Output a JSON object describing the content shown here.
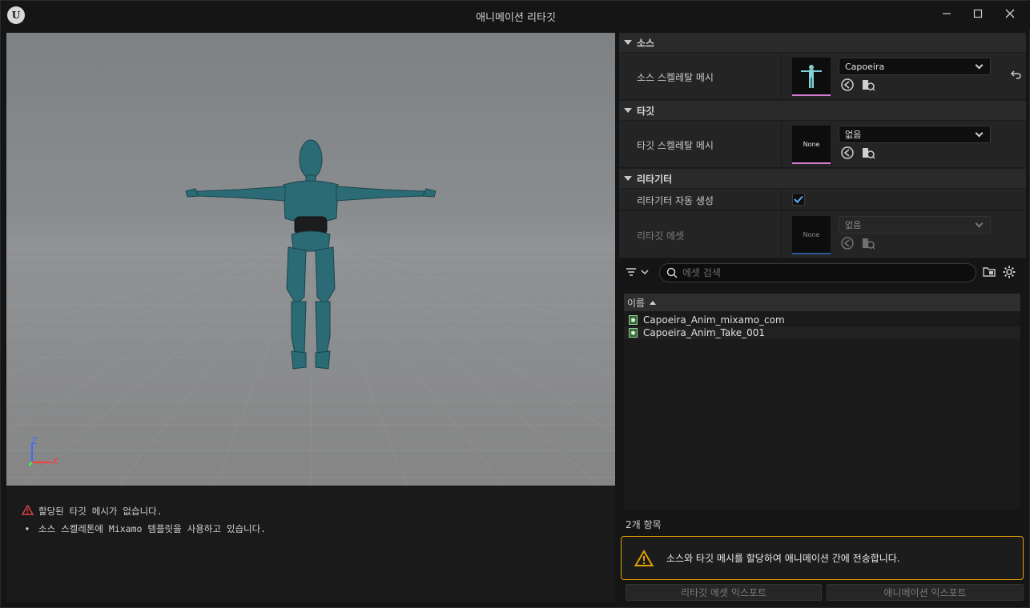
{
  "window": {
    "title": "애니메이션 리타깃",
    "logo_glyph": "U",
    "minimize_icon": "minimize-icon",
    "maximize_icon": "maximize-icon",
    "close_icon": "close-icon"
  },
  "viewport": {
    "axis_labels": {
      "z": "Z",
      "x": "X"
    },
    "axis_colors": {
      "z": "#3c6cff",
      "x": "#ff3c3c",
      "y": "#3cff3c"
    },
    "character_color": "#2b6b76"
  },
  "messages": [
    {
      "icon": "warning-icon",
      "text": "할당된 타깃 메시가 없습니다."
    },
    {
      "icon": "bullet",
      "text": "소스 스켈레톤에 Mixamo 템플릿을 사용하고 있습니다."
    }
  ],
  "details": {
    "source": {
      "header": "소스",
      "mesh_label": "소스 스켈레탈 메시",
      "mesh_value": "Capoeira",
      "reset_icon": "reset-arrow-icon"
    },
    "target": {
      "header": "타깃",
      "mesh_label": "타깃 스켈레탈 메시",
      "mesh_value": "없음",
      "thumb_text": "None"
    },
    "retargeter": {
      "header": "리타기터",
      "auto_generate_label": "리타기터 자동 생성",
      "auto_generate_checked": true,
      "asset_label": "리타깃 에셋",
      "asset_value": "없음",
      "thumb_text": "None"
    }
  },
  "asset_picker": {
    "search_placeholder": "에셋 검색",
    "column_name": "이름",
    "items": [
      "Capoeira_Anim_mixamo_com",
      "Capoeira_Anim_Take_001"
    ],
    "count_text": "2개 항목"
  },
  "notice": {
    "text": "소스와 타깃 메시를 할당하여 애니메이션 간에 전송합니다.",
    "accent": "#e0a000"
  },
  "buttons": {
    "export_retarget_asset": "리타깃 에셋 익스포트",
    "export_animations": "애니메이션 익스포트"
  }
}
